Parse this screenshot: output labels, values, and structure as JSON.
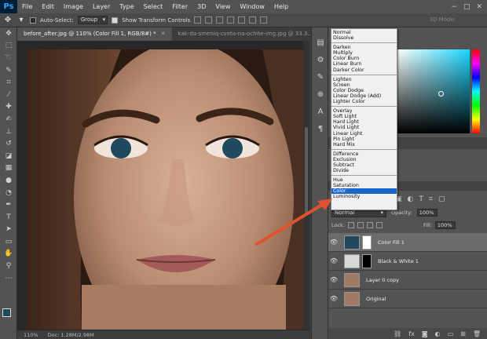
{
  "app": {
    "logo": "Ps"
  },
  "menu": [
    "File",
    "Edit",
    "Image",
    "Layer",
    "Type",
    "Select",
    "Filter",
    "3D",
    "View",
    "Window",
    "Help"
  ],
  "window_controls": [
    "−",
    "□",
    "✕"
  ],
  "options_bar": {
    "auto_select_label": "Auto-Select:",
    "auto_select_value": "Group",
    "transform_label": "Show Transform Controls",
    "mode_3d": "3D Mode:"
  },
  "doc_tabs": [
    {
      "label": "before_after.jpg @ 110% (Color Fill 1, RGB/8#) *"
    },
    {
      "label": "kak-da-smeniq-cveta-na-ochite-img.jpg @ 33.3..."
    }
  ],
  "status_bar": {
    "zoom": "110%",
    "doc": "Doc: 1.28M/2.98M"
  },
  "blend_modes": [
    [
      "Normal",
      "Dissolve"
    ],
    [
      "Darken",
      "Multiply",
      "Color Burn",
      "Linear Burn",
      "Darker Color"
    ],
    [
      "Lighten",
      "Screen",
      "Color Dodge",
      "Linear Dodge (Add)",
      "Lighter Color"
    ],
    [
      "Overlay",
      "Soft Light",
      "Hard Light",
      "Vivid Light",
      "Linear Light",
      "Pin Light",
      "Hard Mix"
    ],
    [
      "Difference",
      "Exclusion",
      "Subtract",
      "Divide"
    ],
    [
      "Hue",
      "Saturation",
      "Color",
      "Luminosity"
    ]
  ],
  "blend_selected": "Color",
  "layers_panel": {
    "blend_value": "Normal",
    "opacity_label": "Opacity:",
    "opacity_value": "100%",
    "lock_label": "Lock:",
    "fill_label": "Fill:",
    "fill_value": "100%",
    "layers": [
      {
        "name": "Color Fill 1",
        "selected": true,
        "thumb": "#1f4a5d",
        "mask": "#ffffff"
      },
      {
        "name": "Black & White 1",
        "selected": false,
        "thumb": "#d9d9d9",
        "mask": "#000000"
      },
      {
        "name": "Layer 0 copy",
        "selected": false,
        "thumb": "#a07a60",
        "mask": null
      },
      {
        "name": "Original",
        "selected": false,
        "thumb": "#a07a60",
        "mask": null
      }
    ]
  },
  "colors": {
    "accent_selection": "#1b67c9",
    "fill_color": "#1f4a5d",
    "arrow": "#e0522f"
  },
  "tools": [
    "move-icon",
    "marquee-icon",
    "lasso-icon",
    "quick-select-icon",
    "crop-icon",
    "eyedropper-icon",
    "healing-icon",
    "brush-icon",
    "clone-stamp-icon",
    "history-brush-icon",
    "eraser-icon",
    "gradient-icon",
    "blur-icon",
    "dodge-icon",
    "pen-icon",
    "type-icon",
    "path-select-icon",
    "shape-icon",
    "hand-icon",
    "zoom-icon",
    "more-tools-icon"
  ]
}
